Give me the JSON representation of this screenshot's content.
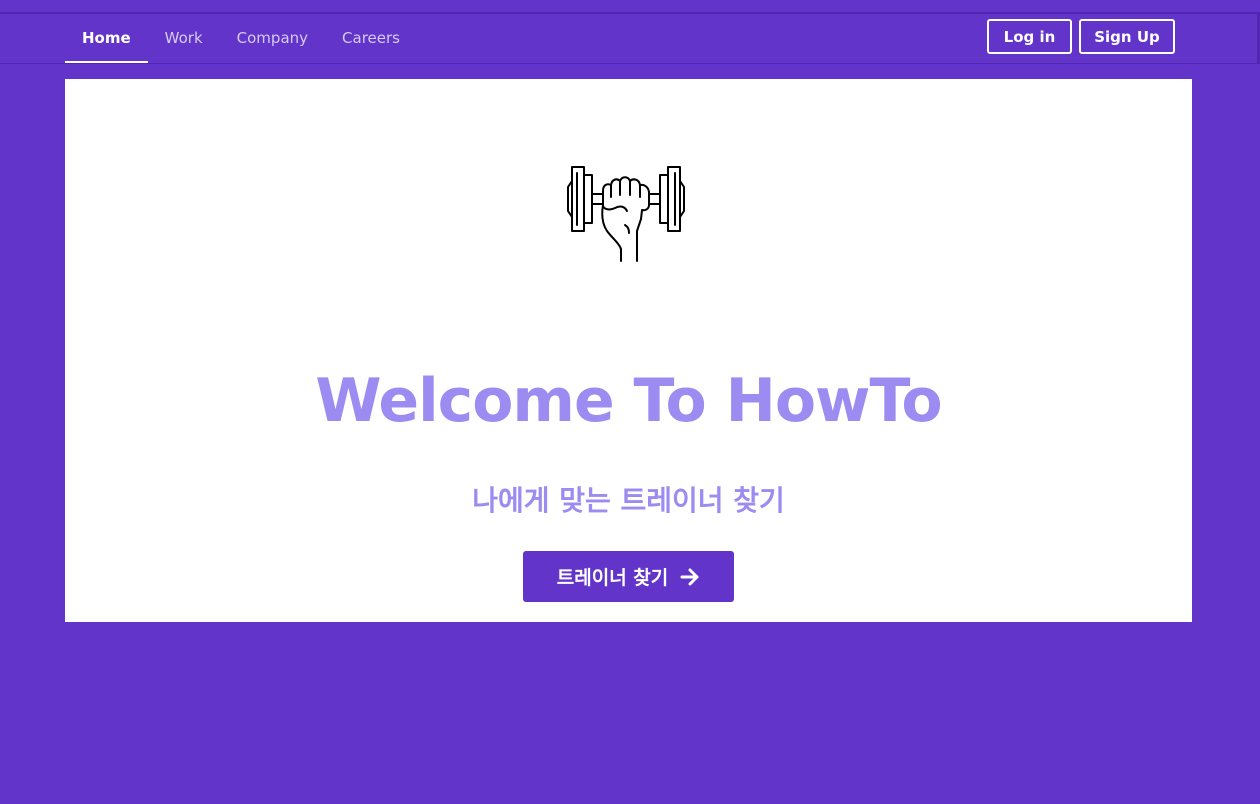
{
  "nav": {
    "links": [
      {
        "label": "Home",
        "active": true
      },
      {
        "label": "Work",
        "active": false
      },
      {
        "label": "Company",
        "active": false
      },
      {
        "label": "Careers",
        "active": false
      }
    ],
    "login_label": "Log in",
    "signup_label": "Sign Up"
  },
  "hero": {
    "icon": "dumbbell-fist-icon",
    "title": "Welcome To HowTo",
    "subtitle": "나에게 맞는 트레이너 찾기",
    "cta_label": "트레이너 찾기",
    "cta_icon": "arrow-right-icon"
  },
  "colors": {
    "primary": "#6234c9",
    "accent_text": "#9c8bf1",
    "surface": "#ffffff"
  }
}
